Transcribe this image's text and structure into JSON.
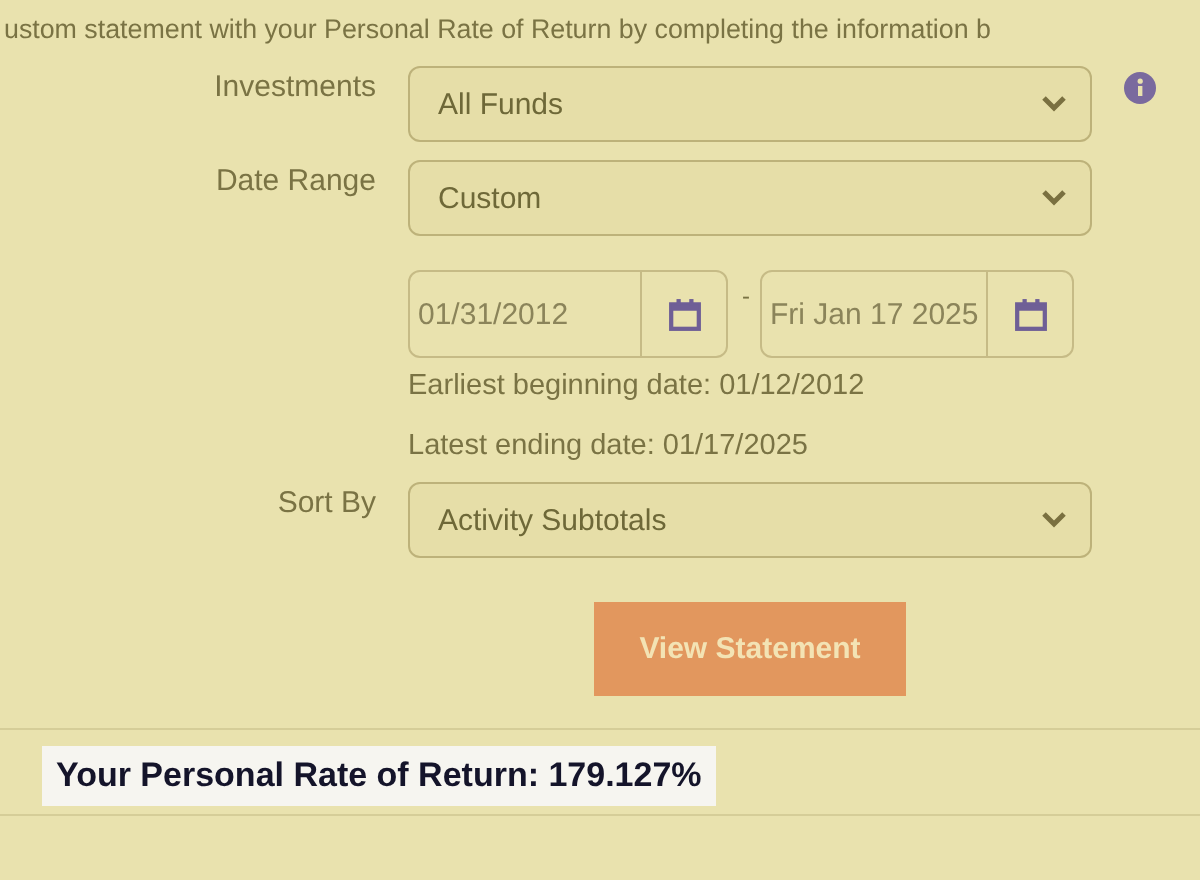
{
  "intro": "ustom statement with your Personal Rate of Return by completing the information b",
  "form": {
    "investments": {
      "label": "Investments",
      "value": "All Funds"
    },
    "date_range": {
      "label": "Date Range",
      "value": "Custom"
    },
    "start_date": {
      "value": "01/31/2012"
    },
    "separator": "-",
    "end_date": {
      "value": "Fri Jan 17 2025"
    },
    "hints": [
      "Earliest beginning date: 01/12/2012",
      "Latest ending date: 01/17/2025"
    ],
    "sort_by": {
      "label": "Sort By",
      "value": "Activity Subtotals"
    },
    "button": "View Statement"
  },
  "result": "Your Personal Rate of Return: 179.127%"
}
